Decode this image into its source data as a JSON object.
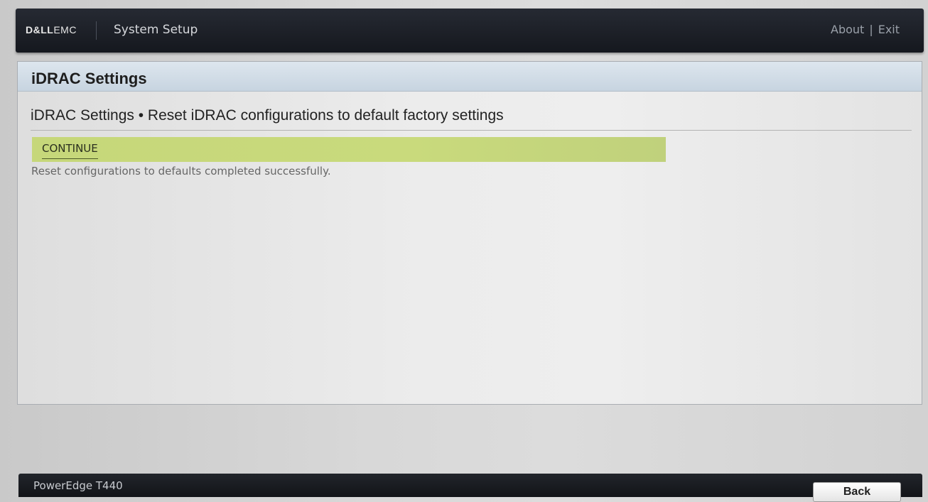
{
  "header": {
    "logo_dell": "D&LL",
    "logo_emc": "EMC",
    "app_title": "System Setup",
    "about_label": "About",
    "separator": "|",
    "exit_label": "Exit"
  },
  "panel": {
    "title": "iDRAC Settings",
    "breadcrumb": "iDRAC Settings • Reset iDRAC configurations to default factory settings",
    "continue_label": "CONTINUE",
    "status_message": "Reset configurations to defaults completed successfully."
  },
  "footer": {
    "model": "PowerEdge T440",
    "back_label": "Back"
  },
  "colors": {
    "top_bar": "#1c1f26",
    "panel_header": "#cfdbe6",
    "continue_highlight": "#c6d77a",
    "status_text": "#666666"
  }
}
